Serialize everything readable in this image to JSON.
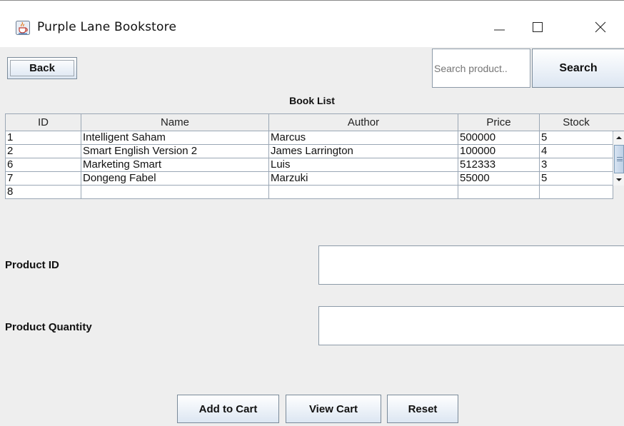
{
  "window": {
    "title": "Purple Lane Bookstore",
    "icon": "java-cup-icon",
    "controls": [
      "minimize-icon",
      "maximize-icon",
      "close-icon"
    ]
  },
  "toolbar": {
    "back_label": "Back",
    "search_placeholder": "Search product..",
    "search_label": "Search"
  },
  "table": {
    "caption": "Book List",
    "columns": [
      "ID",
      "Name",
      "Author",
      "Price",
      "Stock"
    ],
    "rows": [
      [
        "1",
        "Intelligent Saham",
        "Marcus",
        "500000",
        "5"
      ],
      [
        "2",
        "Smart English Version 2",
        "James Larrington",
        "100000",
        "4"
      ],
      [
        "6",
        "Marketing Smart",
        "Luis",
        "512333",
        "3"
      ],
      [
        "7",
        "Dongeng Fabel",
        "Marzuki",
        "55000",
        "5"
      ],
      [
        "8",
        "",
        "",
        "",
        ""
      ]
    ]
  },
  "form": {
    "product_id_label": "Product ID",
    "product_id_value": "",
    "quantity_label": "Product Quantity",
    "quantity_value": ""
  },
  "actions": {
    "add_to_cart": "Add to Cart",
    "view_cart": "View Cart",
    "reset": "Reset"
  },
  "colors": {
    "window_bg": "#eeeeee",
    "button_gradient_bottom": "#dce6f2",
    "border": "#7a8a99",
    "scroll_thumb": "#bdd0e6"
  }
}
